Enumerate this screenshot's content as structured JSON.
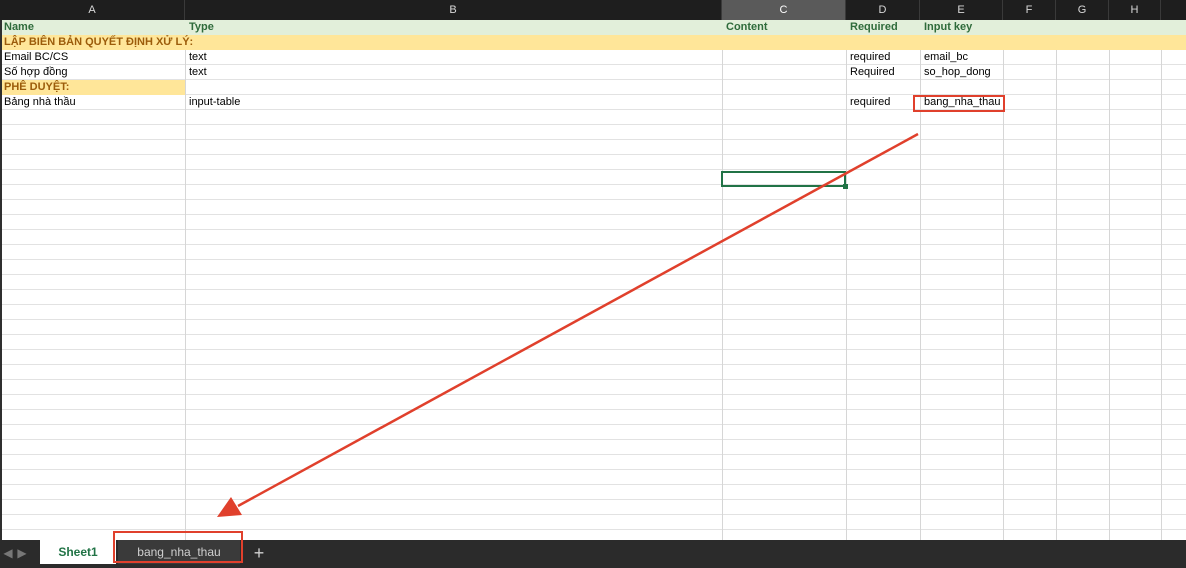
{
  "columns": [
    "A",
    "B",
    "C",
    "D",
    "E",
    "F",
    "G",
    "H"
  ],
  "selected_column": "C",
  "headers": {
    "name": "Name",
    "type": "Type",
    "content": "Content",
    "required": "Required",
    "input_key": "Input key"
  },
  "sections": [
    {
      "title": "LẬP BIÊN BẢN QUYẾT ĐỊNH XỬ LÝ:"
    },
    {
      "title": "PHÊ DUYỆT:"
    }
  ],
  "rows": [
    {
      "name": "Email BC/CS",
      "type": "text",
      "required": "required",
      "input_key": "email_bc"
    },
    {
      "name": "Số hợp đồng",
      "type": "text",
      "required": "Required",
      "input_key": "so_hop_dong"
    },
    {
      "name": "Bảng nhà thầu",
      "type": "input-table",
      "required": "required",
      "input_key": "bang_nha_thau"
    }
  ],
  "tabs": {
    "sheet1": "Sheet1",
    "sheet2": "bang_nha_thau",
    "add": "+"
  },
  "colors": {
    "header_bg": "#e2efda",
    "section_bg": "#ffe699",
    "section_text": "#9c5c0b",
    "header_text": "#2f6b3b",
    "annotation": "#e0402c",
    "selection": "#217346"
  }
}
